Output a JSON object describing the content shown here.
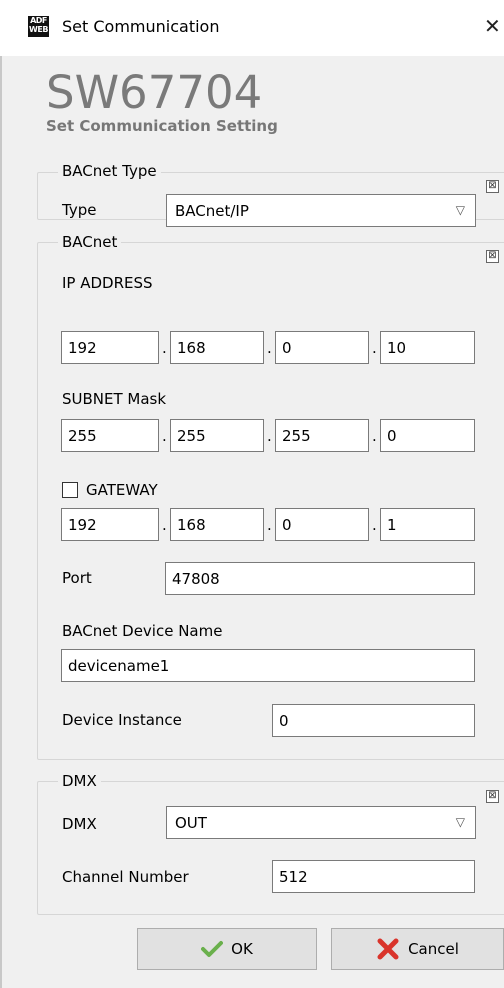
{
  "window": {
    "title": "Set Communication",
    "close_glyph": "✕",
    "app_icon_text": "ADF WEB"
  },
  "header": {
    "product": "SW67704",
    "subtitle": "Set Communication Setting"
  },
  "bacnet_type": {
    "legend": "BACnet Type",
    "type_label": "Type",
    "type_value": "BACnet/IP"
  },
  "bacnet": {
    "legend": "BACnet",
    "ip_label": "IP ADDRESS",
    "ip": [
      "192",
      "168",
      "0",
      "10"
    ],
    "subnet_label": "SUBNET Mask",
    "subnet": [
      "255",
      "255",
      "255",
      "0"
    ],
    "gateway_label": "GATEWAY",
    "gateway_checked": false,
    "gateway": [
      "192",
      "168",
      "0",
      "1"
    ],
    "port_label": "Port",
    "port": "47808",
    "device_name_label": "BACnet Device Name",
    "device_name": "devicename1",
    "device_instance_label": "Device Instance",
    "device_instance": "0"
  },
  "dmx": {
    "legend": "DMX",
    "dmx_label": "DMX",
    "dmx_value": "OUT",
    "channel_label": "Channel Number",
    "channel_value": "512"
  },
  "buttons": {
    "ok": "OK",
    "cancel": "Cancel"
  },
  "icons": {
    "collapse": "collapse-icon",
    "ok": "checkmark-icon",
    "cancel": "cross-icon",
    "dropdown": "chevron-down-icon"
  },
  "colors": {
    "ok_check": "#6ab04c",
    "cancel_x": "#d9342b",
    "title_gray": "#7a7a7a"
  }
}
